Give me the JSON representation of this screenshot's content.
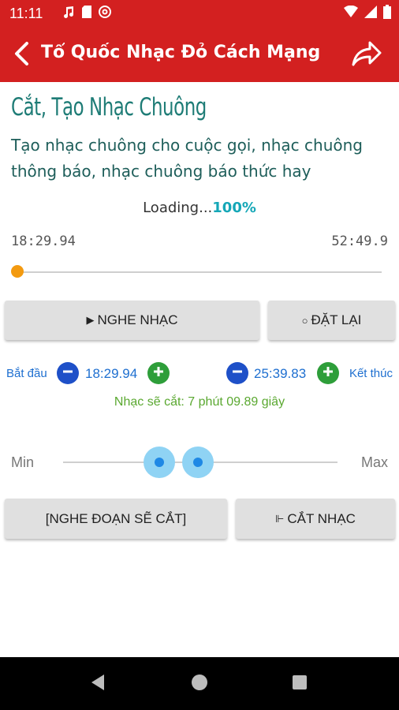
{
  "status_bar": {
    "time": "11:11",
    "left_icons": [
      "music-icon",
      "sd-card-icon",
      "at-sign-icon"
    ],
    "right_icons": [
      "wifi-icon",
      "cell-signal-icon",
      "battery-icon"
    ]
  },
  "app_bar": {
    "title": "Tổ Quốc Nhạc Đỏ Cách Mạng",
    "back_icon": "chevron-left-icon",
    "share_icon": "share-icon",
    "color": "#d32020"
  },
  "content": {
    "heading": "Cắt, Tạo Nhạc Chuông",
    "subheading": "Tạo nhạc chuông cho cuộc gọi, nhạc chuông thông báo, nhạc chuông báo thức hay",
    "loading_label": "Loading...",
    "loading_percent": "100%",
    "current_time": "18:29.94",
    "total_time": "52:49.9",
    "progress_fraction": 0.0
  },
  "buttons": {
    "play_label": "NGHE NHẠC",
    "play_glyph": "▶",
    "reset_label": "ĐẶT LẠI",
    "reset_glyph": "○",
    "preview_label": "[NGHE ĐOẠN SẼ CẮT]",
    "cut_label": "CẮT NHẠC",
    "cut_glyph": "⊩"
  },
  "controls": {
    "start_label": "Bắt đầu",
    "start_value": "18:29.94",
    "end_label": "Kết thúc",
    "end_value": "25:39.83",
    "cut_info": "Nhạc sẽ cắt: 7 phút 09.89 giây"
  },
  "range": {
    "min_label": "Min",
    "max_label": "Max",
    "low_fraction": 0.35,
    "high_fraction": 0.49
  },
  "nav": {
    "icons": [
      "back-triangle-icon",
      "home-circle-icon",
      "recents-square-icon"
    ]
  }
}
